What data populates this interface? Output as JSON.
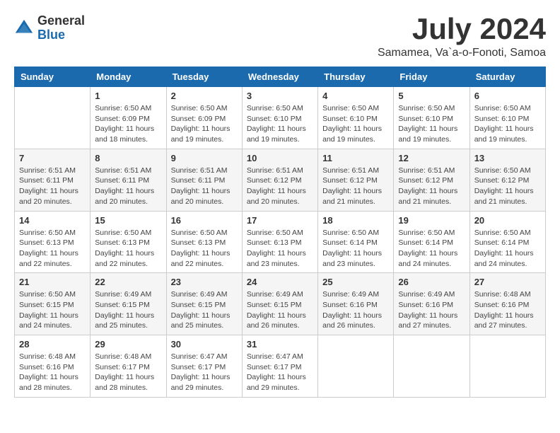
{
  "logo": {
    "general": "General",
    "blue": "Blue"
  },
  "title": "July 2024",
  "location": "Samamea, Va`a-o-Fonoti, Samoa",
  "days_of_week": [
    "Sunday",
    "Monday",
    "Tuesday",
    "Wednesday",
    "Thursday",
    "Friday",
    "Saturday"
  ],
  "weeks": [
    [
      {
        "day": "",
        "sunrise": "",
        "sunset": "",
        "daylight": ""
      },
      {
        "day": "1",
        "sunrise": "Sunrise: 6:50 AM",
        "sunset": "Sunset: 6:09 PM",
        "daylight": "Daylight: 11 hours and 18 minutes."
      },
      {
        "day": "2",
        "sunrise": "Sunrise: 6:50 AM",
        "sunset": "Sunset: 6:09 PM",
        "daylight": "Daylight: 11 hours and 19 minutes."
      },
      {
        "day": "3",
        "sunrise": "Sunrise: 6:50 AM",
        "sunset": "Sunset: 6:10 PM",
        "daylight": "Daylight: 11 hours and 19 minutes."
      },
      {
        "day": "4",
        "sunrise": "Sunrise: 6:50 AM",
        "sunset": "Sunset: 6:10 PM",
        "daylight": "Daylight: 11 hours and 19 minutes."
      },
      {
        "day": "5",
        "sunrise": "Sunrise: 6:50 AM",
        "sunset": "Sunset: 6:10 PM",
        "daylight": "Daylight: 11 hours and 19 minutes."
      },
      {
        "day": "6",
        "sunrise": "Sunrise: 6:50 AM",
        "sunset": "Sunset: 6:10 PM",
        "daylight": "Daylight: 11 hours and 19 minutes."
      }
    ],
    [
      {
        "day": "7",
        "sunrise": "Sunrise: 6:51 AM",
        "sunset": "Sunset: 6:11 PM",
        "daylight": "Daylight: 11 hours and 20 minutes."
      },
      {
        "day": "8",
        "sunrise": "Sunrise: 6:51 AM",
        "sunset": "Sunset: 6:11 PM",
        "daylight": "Daylight: 11 hours and 20 minutes."
      },
      {
        "day": "9",
        "sunrise": "Sunrise: 6:51 AM",
        "sunset": "Sunset: 6:11 PM",
        "daylight": "Daylight: 11 hours and 20 minutes."
      },
      {
        "day": "10",
        "sunrise": "Sunrise: 6:51 AM",
        "sunset": "Sunset: 6:12 PM",
        "daylight": "Daylight: 11 hours and 20 minutes."
      },
      {
        "day": "11",
        "sunrise": "Sunrise: 6:51 AM",
        "sunset": "Sunset: 6:12 PM",
        "daylight": "Daylight: 11 hours and 21 minutes."
      },
      {
        "day": "12",
        "sunrise": "Sunrise: 6:51 AM",
        "sunset": "Sunset: 6:12 PM",
        "daylight": "Daylight: 11 hours and 21 minutes."
      },
      {
        "day": "13",
        "sunrise": "Sunrise: 6:50 AM",
        "sunset": "Sunset: 6:12 PM",
        "daylight": "Daylight: 11 hours and 21 minutes."
      }
    ],
    [
      {
        "day": "14",
        "sunrise": "Sunrise: 6:50 AM",
        "sunset": "Sunset: 6:13 PM",
        "daylight": "Daylight: 11 hours and 22 minutes."
      },
      {
        "day": "15",
        "sunrise": "Sunrise: 6:50 AM",
        "sunset": "Sunset: 6:13 PM",
        "daylight": "Daylight: 11 hours and 22 minutes."
      },
      {
        "day": "16",
        "sunrise": "Sunrise: 6:50 AM",
        "sunset": "Sunset: 6:13 PM",
        "daylight": "Daylight: 11 hours and 22 minutes."
      },
      {
        "day": "17",
        "sunrise": "Sunrise: 6:50 AM",
        "sunset": "Sunset: 6:13 PM",
        "daylight": "Daylight: 11 hours and 23 minutes."
      },
      {
        "day": "18",
        "sunrise": "Sunrise: 6:50 AM",
        "sunset": "Sunset: 6:14 PM",
        "daylight": "Daylight: 11 hours and 23 minutes."
      },
      {
        "day": "19",
        "sunrise": "Sunrise: 6:50 AM",
        "sunset": "Sunset: 6:14 PM",
        "daylight": "Daylight: 11 hours and 24 minutes."
      },
      {
        "day": "20",
        "sunrise": "Sunrise: 6:50 AM",
        "sunset": "Sunset: 6:14 PM",
        "daylight": "Daylight: 11 hours and 24 minutes."
      }
    ],
    [
      {
        "day": "21",
        "sunrise": "Sunrise: 6:50 AM",
        "sunset": "Sunset: 6:15 PM",
        "daylight": "Daylight: 11 hours and 24 minutes."
      },
      {
        "day": "22",
        "sunrise": "Sunrise: 6:49 AM",
        "sunset": "Sunset: 6:15 PM",
        "daylight": "Daylight: 11 hours and 25 minutes."
      },
      {
        "day": "23",
        "sunrise": "Sunrise: 6:49 AM",
        "sunset": "Sunset: 6:15 PM",
        "daylight": "Daylight: 11 hours and 25 minutes."
      },
      {
        "day": "24",
        "sunrise": "Sunrise: 6:49 AM",
        "sunset": "Sunset: 6:15 PM",
        "daylight": "Daylight: 11 hours and 26 minutes."
      },
      {
        "day": "25",
        "sunrise": "Sunrise: 6:49 AM",
        "sunset": "Sunset: 6:16 PM",
        "daylight": "Daylight: 11 hours and 26 minutes."
      },
      {
        "day": "26",
        "sunrise": "Sunrise: 6:49 AM",
        "sunset": "Sunset: 6:16 PM",
        "daylight": "Daylight: 11 hours and 27 minutes."
      },
      {
        "day": "27",
        "sunrise": "Sunrise: 6:48 AM",
        "sunset": "Sunset: 6:16 PM",
        "daylight": "Daylight: 11 hours and 27 minutes."
      }
    ],
    [
      {
        "day": "28",
        "sunrise": "Sunrise: 6:48 AM",
        "sunset": "Sunset: 6:16 PM",
        "daylight": "Daylight: 11 hours and 28 minutes."
      },
      {
        "day": "29",
        "sunrise": "Sunrise: 6:48 AM",
        "sunset": "Sunset: 6:17 PM",
        "daylight": "Daylight: 11 hours and 28 minutes."
      },
      {
        "day": "30",
        "sunrise": "Sunrise: 6:47 AM",
        "sunset": "Sunset: 6:17 PM",
        "daylight": "Daylight: 11 hours and 29 minutes."
      },
      {
        "day": "31",
        "sunrise": "Sunrise: 6:47 AM",
        "sunset": "Sunset: 6:17 PM",
        "daylight": "Daylight: 11 hours and 29 minutes."
      },
      {
        "day": "",
        "sunrise": "",
        "sunset": "",
        "daylight": ""
      },
      {
        "day": "",
        "sunrise": "",
        "sunset": "",
        "daylight": ""
      },
      {
        "day": "",
        "sunrise": "",
        "sunset": "",
        "daylight": ""
      }
    ]
  ]
}
